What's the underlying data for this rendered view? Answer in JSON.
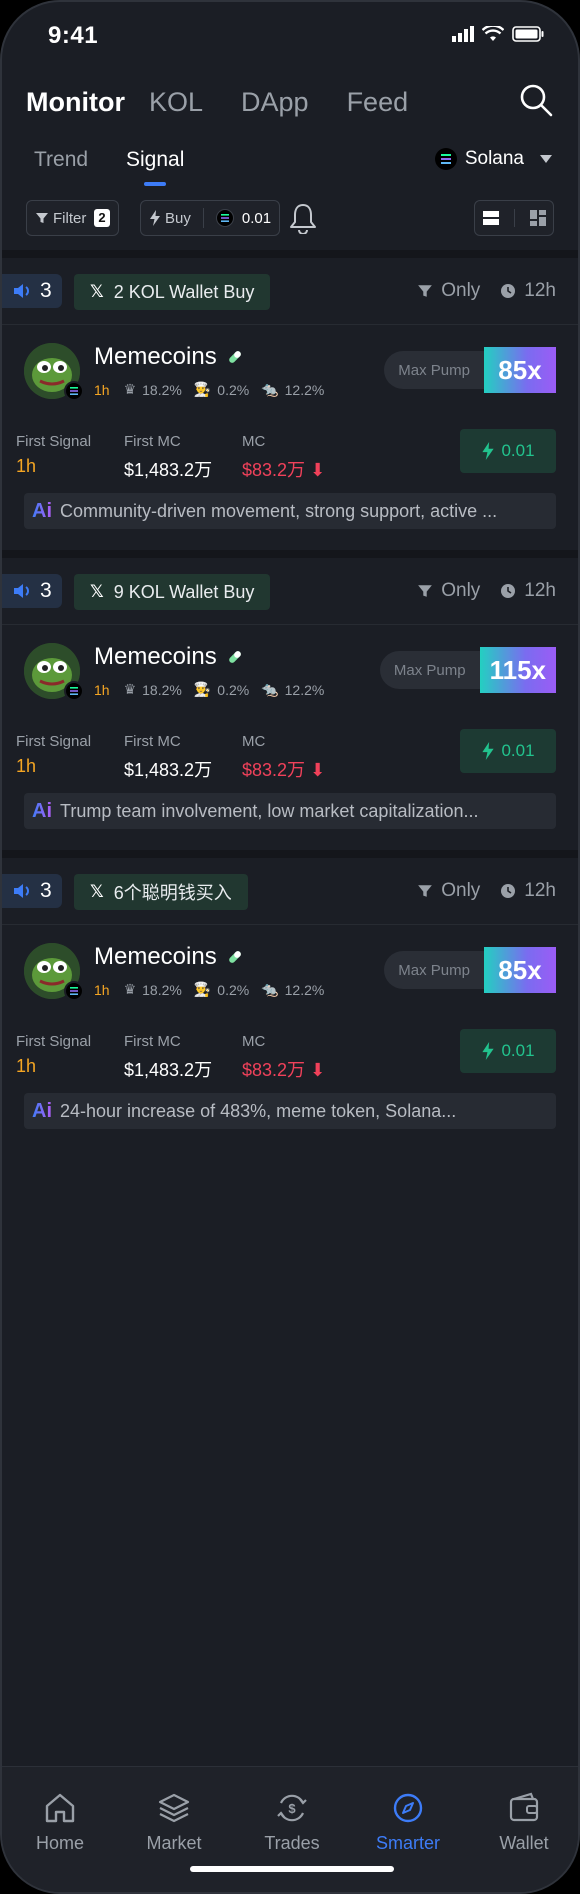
{
  "status_bar": {
    "time": "9:41"
  },
  "top_nav": {
    "tabs": [
      "Monitor",
      "KOL",
      "DApp",
      "Feed"
    ]
  },
  "sub_tabs": {
    "tabs": [
      "Trend",
      "Signal"
    ],
    "active": "Signal"
  },
  "chain_selector": {
    "label": "Solana"
  },
  "filters": {
    "filter_label": "Filter",
    "filter_count": "2",
    "buy_label": "Buy",
    "buy_amount": "0.01"
  },
  "cards": [
    {
      "speaker_count": "3",
      "kol_label": "2 KOL Wallet Buy",
      "only_label": "Only",
      "time_label": "12h",
      "token_name": "Memecoins",
      "age": "1h",
      "stat1": "18.2%",
      "stat2": "0.2%",
      "stat3": "12.2%",
      "max_pump_label": "Max Pump",
      "max_pump_value": "85x",
      "first_signal_label": "First Signal",
      "first_signal_value": "1h",
      "first_mc_label": "First MC",
      "first_mc_value": "$1,483.2万",
      "mc_label": "MC",
      "mc_value": "$83.2万",
      "buy_value": "0.01",
      "ai_text": "Community-driven movement, strong support, active ..."
    },
    {
      "speaker_count": "3",
      "kol_label": "9 KOL Wallet Buy",
      "only_label": "Only",
      "time_label": "12h",
      "token_name": "Memecoins",
      "age": "1h",
      "stat1": "18.2%",
      "stat2": "0.2%",
      "stat3": "12.2%",
      "max_pump_label": "Max Pump",
      "max_pump_value": "115x",
      "first_signal_label": "First Signal",
      "first_signal_value": "1h",
      "first_mc_label": "First MC",
      "first_mc_value": "$1,483.2万",
      "mc_label": "MC",
      "mc_value": "$83.2万",
      "buy_value": "0.01",
      "ai_text": "Trump team involvement, low market capitalization..."
    },
    {
      "speaker_count": "3",
      "kol_label": "6个聪明钱买入",
      "only_label": "Only",
      "time_label": "12h",
      "token_name": "Memecoins",
      "age": "1h",
      "stat1": "18.2%",
      "stat2": "0.2%",
      "stat3": "12.2%",
      "max_pump_label": "Max Pump",
      "max_pump_value": "85x",
      "first_signal_label": "First Signal",
      "first_signal_value": "1h",
      "first_mc_label": "First MC",
      "first_mc_value": "$1,483.2万",
      "mc_label": "MC",
      "mc_value": "$83.2万",
      "buy_value": "0.01",
      "ai_text": "24-hour increase of 483%, meme token, Solana..."
    }
  ],
  "tab_bar": {
    "items": [
      {
        "label": "Home",
        "icon": "home-icon"
      },
      {
        "label": "Market",
        "icon": "layers-icon"
      },
      {
        "label": "Trades",
        "icon": "dollar-swap-icon"
      },
      {
        "label": "Smarter",
        "icon": "compass-icon"
      },
      {
        "label": "Wallet",
        "icon": "wallet-icon"
      }
    ],
    "active": "Smarter"
  },
  "colors": {
    "background": "#1b1e25",
    "accent": "#3d7cf7",
    "green": "#22c38e",
    "red": "#f0415a",
    "orange": "#f5a623"
  }
}
